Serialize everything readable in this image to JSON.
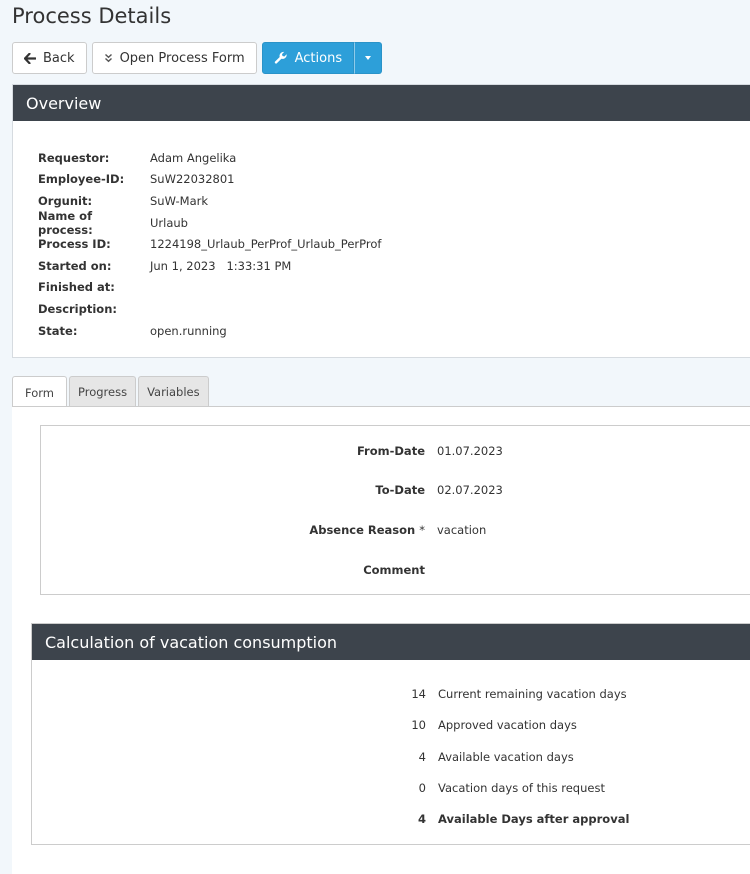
{
  "page": {
    "title": "Process Details"
  },
  "toolbar": {
    "back_label": "Back",
    "open_form_label": "Open Process Form",
    "actions_label": "Actions"
  },
  "overview": {
    "title": "Overview",
    "rows": [
      {
        "label": "Requestor:",
        "value": "Adam Angelika"
      },
      {
        "label": "Employee-ID:",
        "value": "SuW22032801"
      },
      {
        "label": "Orgunit:",
        "value": "SuW-Mark"
      },
      {
        "label": "Name of process:",
        "value": "Urlaub"
      },
      {
        "label": "Process ID:",
        "value": "1224198_Urlaub_PerProf_Urlaub_PerProf"
      },
      {
        "label": "Started on:",
        "value": "Jun 1, 2023   1:33:31 PM"
      },
      {
        "label": "Finished at:",
        "value": ""
      },
      {
        "label": "Description:",
        "value": ""
      },
      {
        "label": "State:",
        "value": "open.running"
      }
    ]
  },
  "tabs": [
    {
      "label": "Form",
      "active": true
    },
    {
      "label": "Progress",
      "active": false
    },
    {
      "label": "Variables",
      "active": false
    }
  ],
  "form": {
    "fields": [
      {
        "label": "From-Date",
        "value": "01.07.2023",
        "required": false
      },
      {
        "label": "To-Date",
        "value": "02.07.2023",
        "required": false
      },
      {
        "label": "Absence Reason",
        "value": "vacation",
        "required": true,
        "required_mark": "*"
      },
      {
        "label": "Comment",
        "value": "",
        "required": false
      }
    ]
  },
  "calculation": {
    "title": "Calculation of vacation consumption",
    "rows": [
      {
        "number": "14",
        "text": "Current remaining vacation days",
        "bold": false
      },
      {
        "number": "10",
        "text": "Approved vacation days",
        "bold": false
      },
      {
        "number": "4",
        "text": "Available vacation days",
        "bold": false
      },
      {
        "number": "0",
        "text": "Vacation days of this request",
        "bold": false
      },
      {
        "number": "4",
        "text": "Available Days after approval",
        "bold": true
      }
    ]
  },
  "icons": {
    "back": "arrow-left-icon",
    "open_form": "double-chevron-down-icon",
    "actions": "wrench-icon",
    "caret": "caret-down-icon"
  },
  "colors": {
    "primary": "#2d9fd9",
    "panel_header": "#3d444c",
    "page_background": "#f2f7fb"
  }
}
